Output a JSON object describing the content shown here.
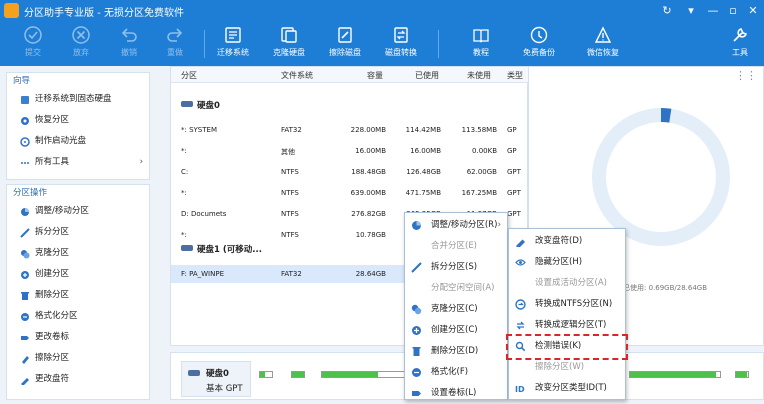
{
  "window": {
    "title": "分区助手专业版 - 无损分区免费软件",
    "controls": [
      "↻",
      "▾",
      "—",
      "▫",
      "✕"
    ]
  },
  "toolbar": {
    "buttons": [
      {
        "label": "提交",
        "icon": "check-icon",
        "enabled": false
      },
      {
        "label": "放弃",
        "icon": "cancel-icon",
        "enabled": false
      },
      {
        "label": "撤销",
        "icon": "undo-icon",
        "enabled": false
      },
      {
        "label": "重做",
        "icon": "redo-icon",
        "enabled": false
      },
      {
        "label": "迁移系统",
        "icon": "migrate-icon",
        "enabled": true
      },
      {
        "label": "克隆硬盘",
        "icon": "clone-disk-icon",
        "enabled": true
      },
      {
        "label": "擦除磁盘",
        "icon": "wipe-disk-icon",
        "enabled": true
      },
      {
        "label": "磁盘转换",
        "icon": "convert-disk-icon",
        "enabled": true
      },
      {
        "label": "教程",
        "icon": "tutorial-icon",
        "enabled": true
      },
      {
        "label": "免费备份",
        "icon": "backup-icon",
        "enabled": true
      },
      {
        "label": "微信恢复",
        "icon": "wechat-restore-icon",
        "enabled": true
      },
      {
        "label": "工具",
        "icon": "tools-icon",
        "enabled": true
      }
    ]
  },
  "sidebar": {
    "wizard": {
      "title": "向导",
      "items": [
        {
          "label": "迁移系统到固态硬盘",
          "icon": "migrate-ssd-icon"
        },
        {
          "label": "恢复分区",
          "icon": "recover-partition-icon"
        },
        {
          "label": "制作启动光盘",
          "icon": "boot-disc-icon"
        },
        {
          "label": "所有工具",
          "icon": "all-tools-icon",
          "arrow": "›"
        }
      ]
    },
    "ops": {
      "title": "分区操作",
      "items": [
        {
          "label": "调整/移动分区",
          "icon": "resize-icon"
        },
        {
          "label": "拆分分区",
          "icon": "split-icon"
        },
        {
          "label": "克隆分区",
          "icon": "clone-icon"
        },
        {
          "label": "创建分区",
          "icon": "create-icon"
        },
        {
          "label": "删除分区",
          "icon": "delete-icon"
        },
        {
          "label": "格式化分区",
          "icon": "format-icon"
        },
        {
          "label": "更改卷标",
          "icon": "label-icon"
        },
        {
          "label": "擦除分区",
          "icon": "erase-icon"
        },
        {
          "label": "更改盘符",
          "icon": "drive-letter-icon"
        }
      ]
    }
  },
  "table": {
    "headers": {
      "partition": "分区",
      "filesystem": "文件系统",
      "capacity": "容量",
      "used": "已使用",
      "unused": "未使用",
      "type": "类型",
      "collapse": "«"
    },
    "disk0": {
      "name": "硬盘0"
    },
    "disk0_rows": [
      {
        "partition": "*: SYSTEM",
        "fs": "FAT32",
        "capacity": "228.00MB",
        "used": "114.42MB",
        "unused": "113.58MB",
        "type": "GP"
      },
      {
        "partition": "*:",
        "fs": "其他",
        "capacity": "16.00MB",
        "used": "16.00MB",
        "unused": "0.00KB",
        "type": "GP"
      },
      {
        "partition": "C:",
        "fs": "NTFS",
        "capacity": "188.48GB",
        "used": "126.48GB",
        "unused": "62.00GB",
        "type": "GPT"
      },
      {
        "partition": "*:",
        "fs": "NTFS",
        "capacity": "639.00MB",
        "used": "471.75MB",
        "unused": "167.25MB",
        "type": "GPT"
      },
      {
        "partition": "D: Documets",
        "fs": "NTFS",
        "capacity": "276.82GB",
        "used": "265.25GB",
        "unused": "11.57GB",
        "type": "GPT"
      },
      {
        "partition": "*:",
        "fs": "NTFS",
        "capacity": "10.78GB",
        "used": "10.23GB",
        "unused": "",
        "type": "GPT"
      }
    ],
    "disk1": {
      "name": "硬盘1 (可移动..."
    },
    "disk1_rows": [
      {
        "partition": "F: PA_WINPE",
        "fs": "FAT32",
        "capacity": "28.64GB",
        "used": "",
        "unused": "",
        "type": ""
      }
    ]
  },
  "rightpane": {
    "capacity_caption": "已使用: 0.69GB/28.64GB",
    "used_fraction": 0.024
  },
  "bottom": {
    "disk_name": "硬盘0",
    "disk_type": "基本 GPT"
  },
  "context_menu": {
    "items": [
      {
        "label": "调整/移动分区(R)",
        "icon": "resize-icon",
        "enabled": true
      },
      {
        "label": "合并分区(E)",
        "icon": "",
        "enabled": false
      },
      {
        "label": "拆分分区(S)",
        "icon": "split-icon",
        "enabled": true
      },
      {
        "label": "分配空闲空间(A)",
        "icon": "",
        "enabled": false
      },
      {
        "label": "克隆分区(C)",
        "icon": "clone-icon",
        "enabled": true
      },
      {
        "label": "创建分区(C)",
        "icon": "create-icon",
        "enabled": true
      },
      {
        "label": "删除分区(D)",
        "icon": "delete-icon",
        "enabled": true
      },
      {
        "label": "格式化(F)",
        "icon": "format-icon",
        "enabled": true
      },
      {
        "label": "设置卷标(L)",
        "icon": "label-icon",
        "enabled": true
      }
    ]
  },
  "submenu": {
    "items": [
      {
        "label": "改变盘符(D)",
        "icon": "drive-letter-icon",
        "enabled": true
      },
      {
        "label": "隐藏分区(H)",
        "icon": "hide-icon",
        "enabled": true
      },
      {
        "label": "设置成活动分区(A)",
        "icon": "",
        "enabled": false
      },
      {
        "label": "转换成NTFS分区(N)",
        "icon": "ntfs-icon",
        "enabled": true
      },
      {
        "label": "转换成逻辑分区(T)",
        "icon": "logical-icon",
        "enabled": true
      },
      {
        "label": "检测错误(K)",
        "icon": "check-error-icon",
        "enabled": true,
        "highlighted": true
      },
      {
        "label": "擦除分区(W)",
        "icon": "",
        "enabled": false
      },
      {
        "label": "改变分区类型ID(T)",
        "icon": "type-id-icon",
        "enabled": true
      }
    ]
  },
  "colors": {
    "brand": "#1e7ed6",
    "highlight": "#d8262a",
    "selection": "#d9e8fb"
  }
}
